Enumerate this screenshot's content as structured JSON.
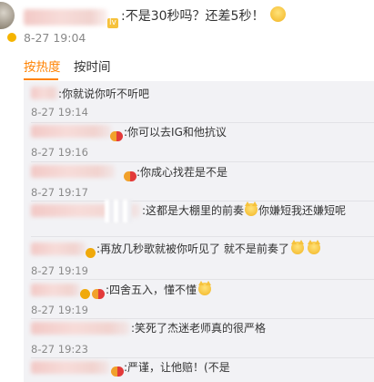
{
  "post": {
    "text": ":不是30秒吗？还差5秒！",
    "level_badge": "lv",
    "time": "8-27 19:04",
    "emoji": "crying-face"
  },
  "tabs": [
    {
      "label": "按热度",
      "active": true
    },
    {
      "label": "按时间",
      "active": false
    }
  ],
  "colors": {
    "accent": "#ff8200",
    "panel_bg": "#f2f2f5",
    "time_gray": "#888888"
  },
  "replies": [
    {
      "text": ":你就说你听不听吧",
      "time": "8-27 19:14"
    },
    {
      "text": ":你可以去IG和他抗议",
      "time": "8-27 19:16"
    },
    {
      "text": ":你成心找茬是不是",
      "time": "8-27 19:17"
    },
    {
      "text": ":这都是大棚里的前奏",
      "text2": "你嫌短我还嫌短呢",
      "time": ""
    },
    {
      "text": ":再放几秒歌就被你听见了 就不是前奏了",
      "time": "8-27 19:19"
    },
    {
      "text": ":四舍五入，懂不懂",
      "time": "8-27 19:19"
    },
    {
      "text": ":笑死了杰迷老师真的很严格",
      "time": "8-27 19:23"
    },
    {
      "text": ":严谨，让他赔！(不是",
      "time": ""
    }
  ]
}
